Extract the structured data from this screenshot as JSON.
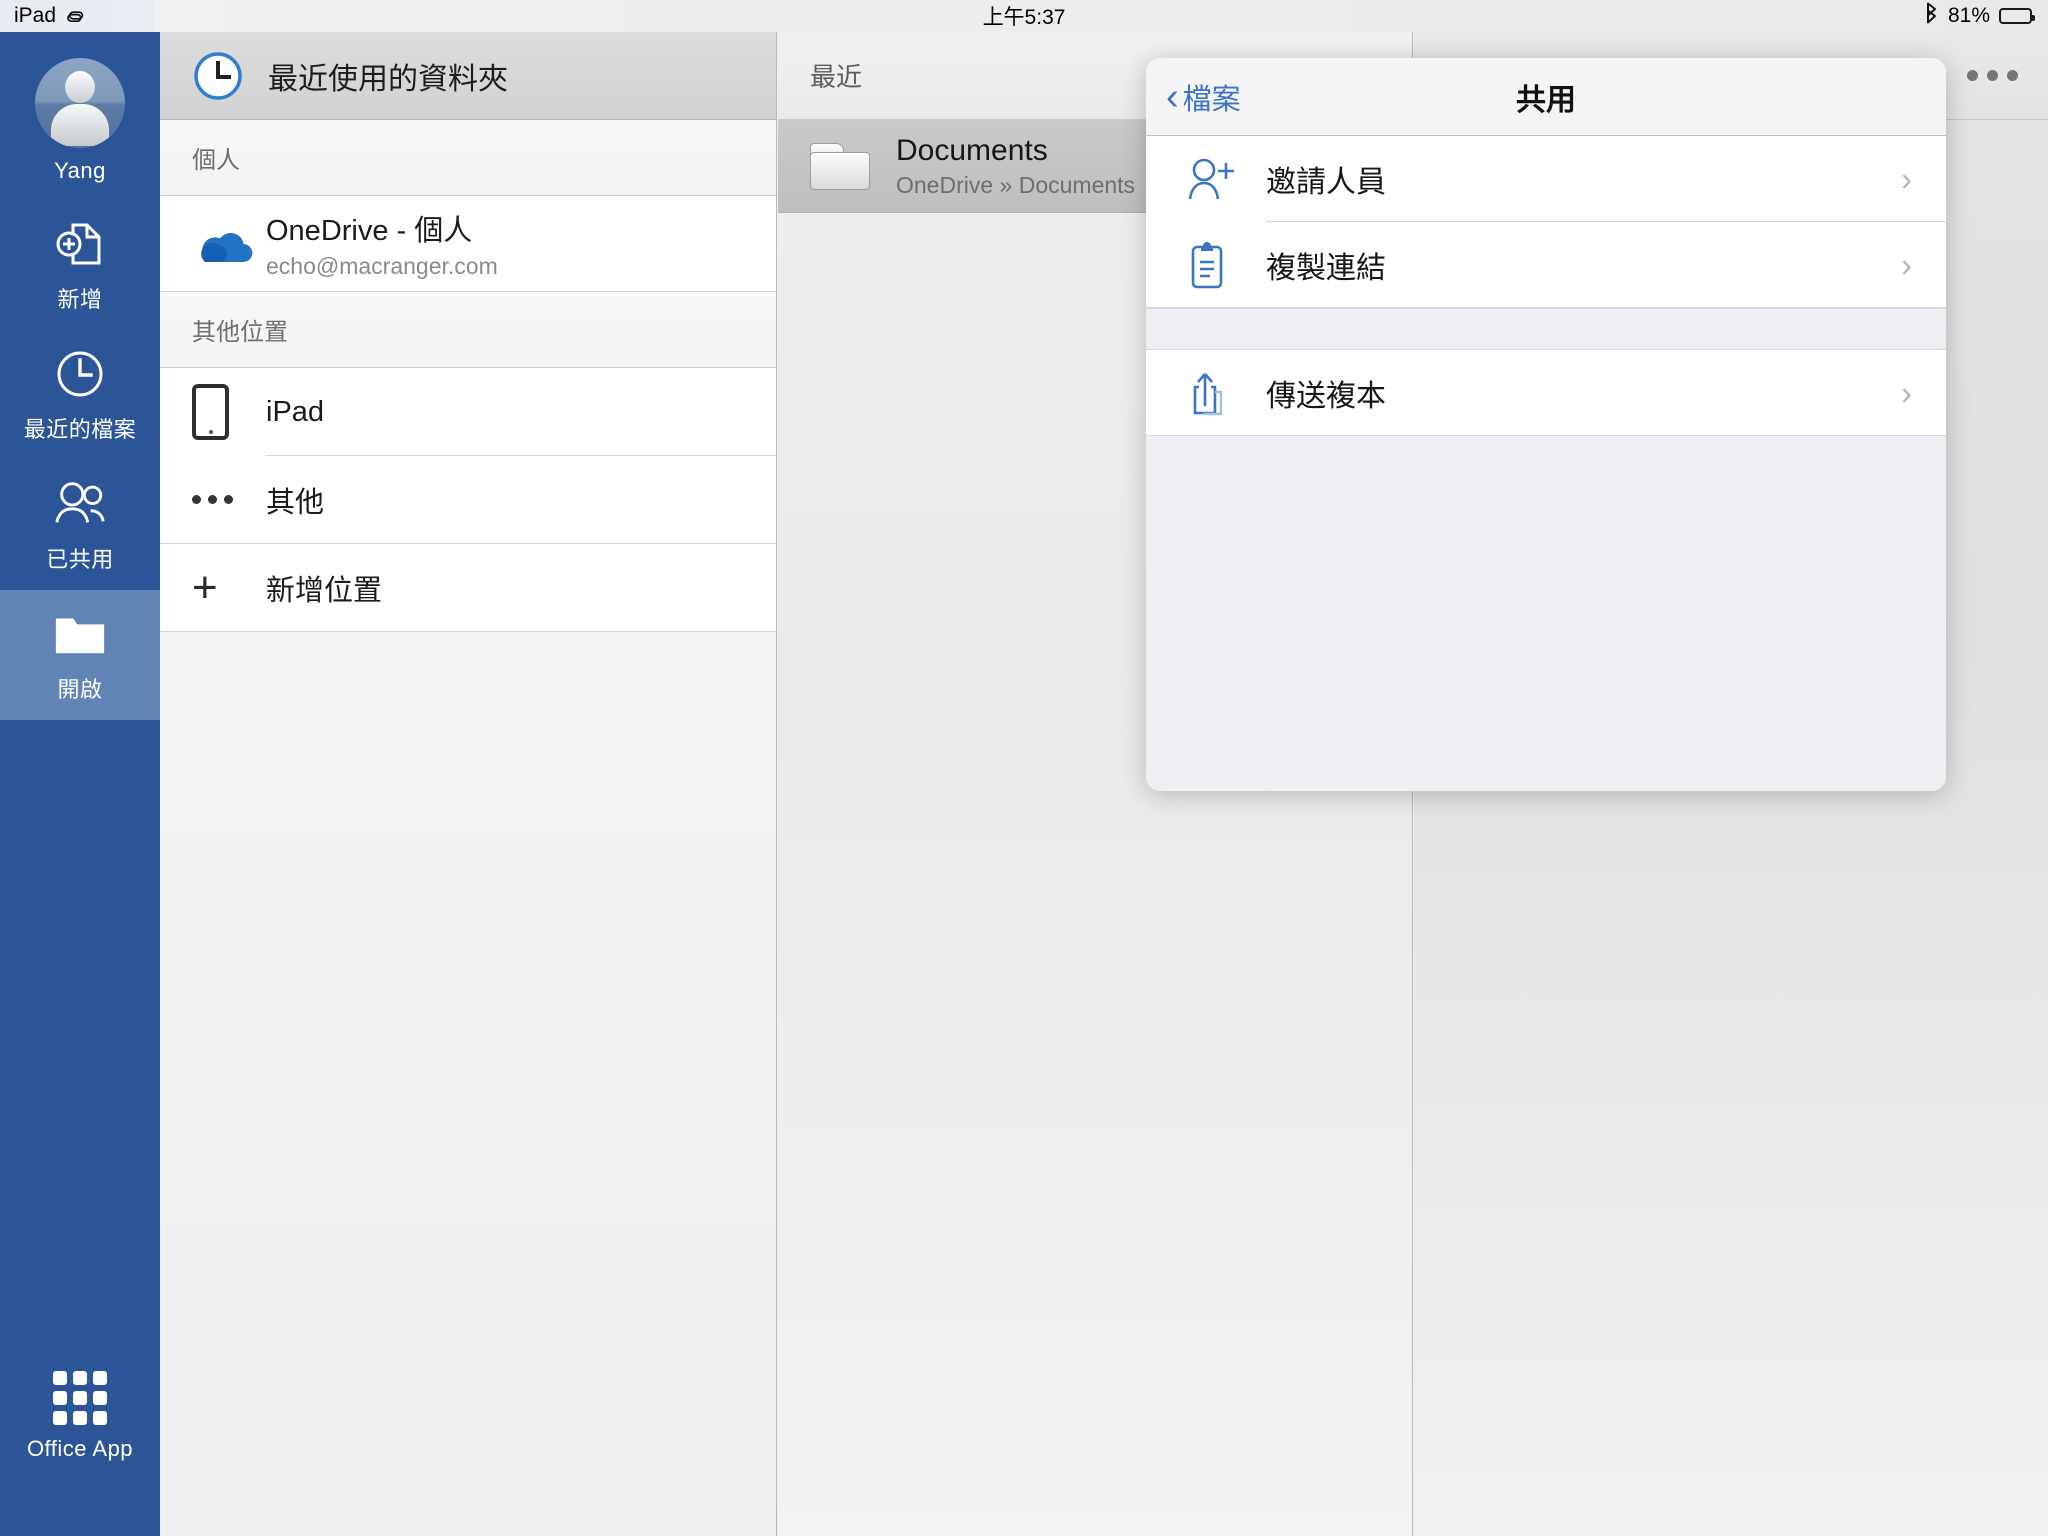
{
  "statusbar": {
    "device_label": "iPad",
    "link_icon": "chain-link-icon",
    "time": "上午5:37",
    "bluetooth_icon": "bluetooth-icon",
    "battery_percent": "81%",
    "battery_icon": "battery-icon"
  },
  "rail": {
    "account_name": "Yang",
    "avatar_icon": "avatar-icon",
    "items": [
      {
        "label": "新增",
        "icon": "new-document-icon",
        "selected": false
      },
      {
        "label": "最近的檔案",
        "icon": "clock-icon",
        "selected": false
      },
      {
        "label": "已共用",
        "icon": "people-icon",
        "selected": false
      },
      {
        "label": "開啟",
        "icon": "folder-icon",
        "selected": true
      }
    ],
    "bottom_item": {
      "label": "Office App",
      "icon": "app-grid-icon"
    },
    "background_color": "#2b5596",
    "selected_color": "#6184b7"
  },
  "places_panel": {
    "header": {
      "title": "最近使用的資料夾",
      "icon": "clock-icon"
    },
    "sections": [
      {
        "title": "個人",
        "rows": [
          {
            "title": "OneDrive - 個人",
            "subtitle": "echo@macranger.com",
            "icon": "onedrive-cloud-icon"
          }
        ]
      },
      {
        "title": "其他位置",
        "rows": [
          {
            "title": "iPad",
            "subtitle": "",
            "icon": "ipad-icon"
          },
          {
            "title": "其他",
            "subtitle": "",
            "icon": "ellipsis-icon"
          },
          {
            "title": "新增位置",
            "subtitle": "",
            "icon": "plus-icon"
          }
        ]
      }
    ]
  },
  "recent_panel": {
    "header": "最近",
    "rows": [
      {
        "title": "Documents",
        "subtitle": "OneDrive » Documents",
        "icon": "folder-icon",
        "selected": true
      }
    ]
  },
  "detail_panel": {
    "overflow_button": "ellipsis-icon"
  },
  "popover": {
    "back_label": "檔案",
    "back_icon": "chevron-left-icon",
    "title": "共用",
    "accent_color": "#3b74c4",
    "groups": [
      {
        "items": [
          {
            "label": "邀請人員",
            "icon": "person-add-icon",
            "chevron": "chevron-right-icon"
          },
          {
            "label": "複製連結",
            "icon": "clipboard-link-icon",
            "chevron": "chevron-right-icon"
          }
        ]
      },
      {
        "items": [
          {
            "label": "傳送複本",
            "icon": "share-export-icon",
            "chevron": "chevron-right-icon"
          }
        ]
      }
    ]
  }
}
